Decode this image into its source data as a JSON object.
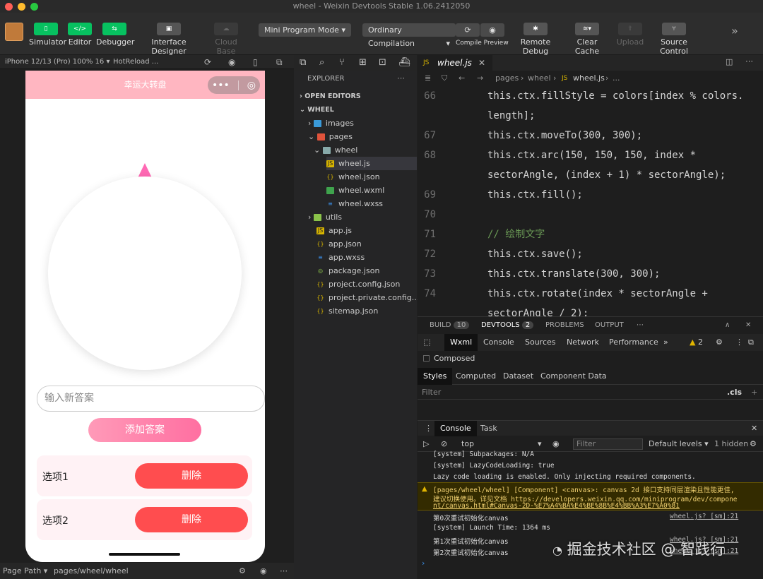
{
  "window": {
    "title": "wheel - Weixin Devtools Stable 1.06.2412050"
  },
  "toolbar": {
    "simulator": "Simulator",
    "editor": "Editor",
    "debugger": "Debugger",
    "interface_designer": "Interface Designer",
    "cloud_base": "Cloud Base",
    "mode": "Mini Program Mode",
    "compilation": "Ordinary Compilation",
    "compile_preview": "Compile Preview",
    "remote_debug": "Remote Debug",
    "clear_cache": "Clear Cache",
    "upload": "Upload",
    "source_control": "Source Control"
  },
  "simulator": {
    "device": "iPhone 12/13 (Pro) 100% 16 ▾",
    "hotreload": "HotReload ...",
    "page_title": "幸运大转盘",
    "input_placeholder": "输入新答案",
    "add_button": "添加答案",
    "options": [
      {
        "label": "选项1",
        "delete": "删除"
      },
      {
        "label": "选项2",
        "delete": "删除"
      }
    ]
  },
  "statusbar": {
    "page_path_label": "Page Path ▾",
    "page_path": "pages/wheel/wheel"
  },
  "explorer": {
    "title": "EXPLORER",
    "open_editors": "OPEN EDITORS",
    "root": "WHEEL",
    "items": [
      {
        "name": "images",
        "kind": "folder"
      },
      {
        "name": "pages",
        "kind": "folder"
      },
      {
        "name": "wheel",
        "kind": "folder"
      },
      {
        "name": "wheel.js",
        "kind": "js"
      },
      {
        "name": "wheel.json",
        "kind": "json"
      },
      {
        "name": "wheel.wxml",
        "kind": "wxml"
      },
      {
        "name": "wheel.wxss",
        "kind": "wxss"
      },
      {
        "name": "utils",
        "kind": "folder"
      },
      {
        "name": "app.js",
        "kind": "js"
      },
      {
        "name": "app.json",
        "kind": "json"
      },
      {
        "name": "app.wxss",
        "kind": "wxss"
      },
      {
        "name": "package.json",
        "kind": "pkg"
      },
      {
        "name": "project.config.json",
        "kind": "json"
      },
      {
        "name": "project.private.config...",
        "kind": "json"
      },
      {
        "name": "sitemap.json",
        "kind": "json"
      }
    ]
  },
  "editor": {
    "tab": "wheel.js",
    "breadcrumb": [
      "pages",
      "wheel",
      "wheel.js",
      "..."
    ],
    "lines": [
      {
        "n": "66",
        "text": "this.ctx.fillStyle = colors[index % colors."
      },
      {
        "n": "",
        "text": "length];"
      },
      {
        "n": "67",
        "text": "this.ctx.moveTo(300, 300);"
      },
      {
        "n": "68",
        "text": "this.ctx.arc(150, 150, 150, index *"
      },
      {
        "n": "",
        "text": "sectorAngle, (index + 1) * sectorAngle);"
      },
      {
        "n": "69",
        "text": "this.ctx.fill();"
      },
      {
        "n": "70",
        "text": ""
      },
      {
        "n": "71",
        "text": "// 绘制文字"
      },
      {
        "n": "72",
        "text": "this.ctx.save();"
      },
      {
        "n": "73",
        "text": "this.ctx.translate(300, 300);"
      },
      {
        "n": "74",
        "text": "this.ctx.rotate(index * sectorAngle +"
      },
      {
        "n": "",
        "text": "sectorAngle / 2);"
      }
    ]
  },
  "panel": {
    "tabs": [
      {
        "label": "BUILD",
        "badge": "10"
      },
      {
        "label": "DEVTOOLS",
        "badge": "2"
      },
      {
        "label": "PROBLEMS",
        "badge": ""
      },
      {
        "label": "OUTPUT",
        "badge": ""
      }
    ],
    "devtools_tabs": [
      "Wxml",
      "Console",
      "Sources",
      "Network",
      "Performance"
    ],
    "warn_count": "2",
    "composed": "Composed",
    "style_tabs": [
      "Styles",
      "Computed",
      "Dataset",
      "Component Data"
    ],
    "filter": "Filter",
    "cls": ".cls",
    "console_tabs": [
      "Console",
      "Task"
    ],
    "context": "top",
    "console_filter": "Filter",
    "levels": "Default levels ▾",
    "hidden": "1 hidden",
    "logs": [
      {
        "text": "[system] Subpackages: N/A",
        "src": ""
      },
      {
        "text": "[system] LazyCodeLoading: true",
        "src": ""
      },
      {
        "text": "Lazy code loading is enabled. Only injecting required components.",
        "src": ""
      },
      {
        "text": "[pages/wheel/wheel] [Component] <canvas>: canvas 2d 接口支持同层渲染且性能更佳,",
        "src": ""
      },
      {
        "text": "建议切换使用。详见文档 https://developers.weixin.qq.com/miniprogram/dev/compone",
        "src": ""
      },
      {
        "text": "nt/canvas.html#Canvas-2D-%E7%A4%BA%E4%BE%8B%E4%BB%A3%E7%A0%81",
        "src": ""
      },
      {
        "text": "第0次重试初始化canvas",
        "src": "wheel.js? [sm]:21"
      },
      {
        "text": "[system] Launch Time: 1364 ms",
        "src": ""
      },
      {
        "text": "第1次重试初始化canvas",
        "src": "wheel.js? [sm]:21"
      },
      {
        "text": "第2次重试初始化canvas",
        "src": "wheel.js? [sm]:21"
      }
    ]
  },
  "watermark": "掘金技术社区 @ 智践行"
}
